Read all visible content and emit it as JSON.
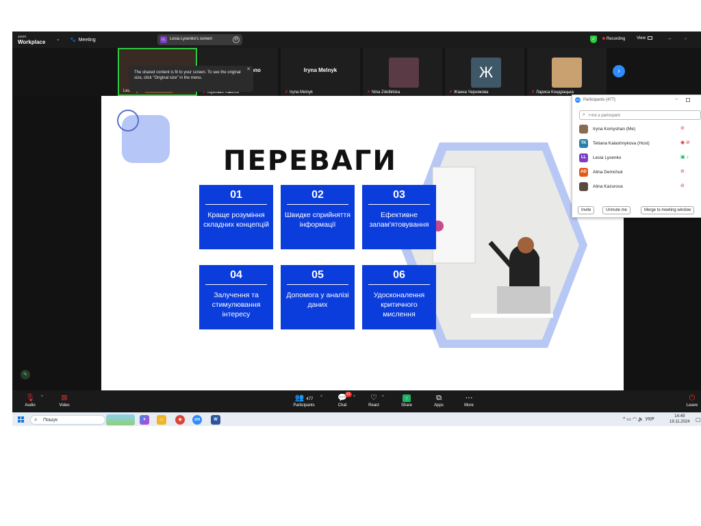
{
  "titlebar": {
    "logo_small": "zoom",
    "logo_big": "Workplace",
    "meeting_label": "Meeting",
    "share_badge": "LL",
    "share_label": "Lesia Lysenko's screen",
    "recording_label": "Recording",
    "view_label": "View"
  },
  "tooltip": {
    "text": "The shared content is fit to your screen. To see the original size, click \"Original size\" in the menu."
  },
  "video_tiles": [
    {
      "name": "Lesia Lysenko"
    },
    {
      "name": "Mykhailo Rakhno",
      "center": "Mykhailo Rakhno"
    },
    {
      "name": "Iryna Melnyk",
      "center": "Iryna Melnyk"
    },
    {
      "name": "Nina Zdolbitska"
    },
    {
      "name": "Жанна Чернякова",
      "initial": "Ж"
    },
    {
      "name": "Лариса Кондрацька"
    }
  ],
  "slide": {
    "title": "ПЕРЕВАГИ",
    "cards": [
      {
        "num": "01",
        "text": "Краще розуміння складних концепцій"
      },
      {
        "num": "02",
        "text": "Швидке сприйняття інформації"
      },
      {
        "num": "03",
        "text": "Ефективне запам'ятовування"
      },
      {
        "num": "04",
        "text": "Залучення та стимулювання інтересу"
      },
      {
        "num": "05",
        "text": "Допомога у аналізі даних"
      },
      {
        "num": "06",
        "text": "Удосконалення критичного мислення"
      }
    ],
    "colors": {
      "card": "#0a3ddc",
      "hexagon": "#b8c8f5",
      "accent_square": "#b5c6f7"
    }
  },
  "participants": {
    "header": "Participants (477)",
    "search_placeholder": "Find a participant",
    "list": [
      {
        "name": "Iryna Komyshan (Me)",
        "avatar": "",
        "color": "#8a6a50"
      },
      {
        "name": "Tetiana Kalashnykova (Host)",
        "avatar": "TK",
        "color": "#2a7fa8"
      },
      {
        "name": "Lesia Lysenko",
        "avatar": "LL",
        "color": "#7b3fc4"
      },
      {
        "name": "Alina Demchuk",
        "avatar": "AD",
        "color": "#e05a1a"
      },
      {
        "name": "Alina Kazurova",
        "avatar": "",
        "color": "#5a4a40"
      }
    ],
    "buttons": {
      "invite": "Invite",
      "unmute": "Unmute me",
      "merge": "Merge to meeting window"
    }
  },
  "toolbar": {
    "audio": "Audio",
    "video": "Video",
    "participants": "Participants",
    "participants_count": "477",
    "chat": "Chat",
    "chat_badge": "61",
    "react": "React",
    "share": "Share",
    "apps": "Apps",
    "more": "More",
    "leave": "Leave"
  },
  "taskbar": {
    "search": "Пошук",
    "lang": "УКР",
    "time": "14:49",
    "date": "19.11.2024"
  }
}
